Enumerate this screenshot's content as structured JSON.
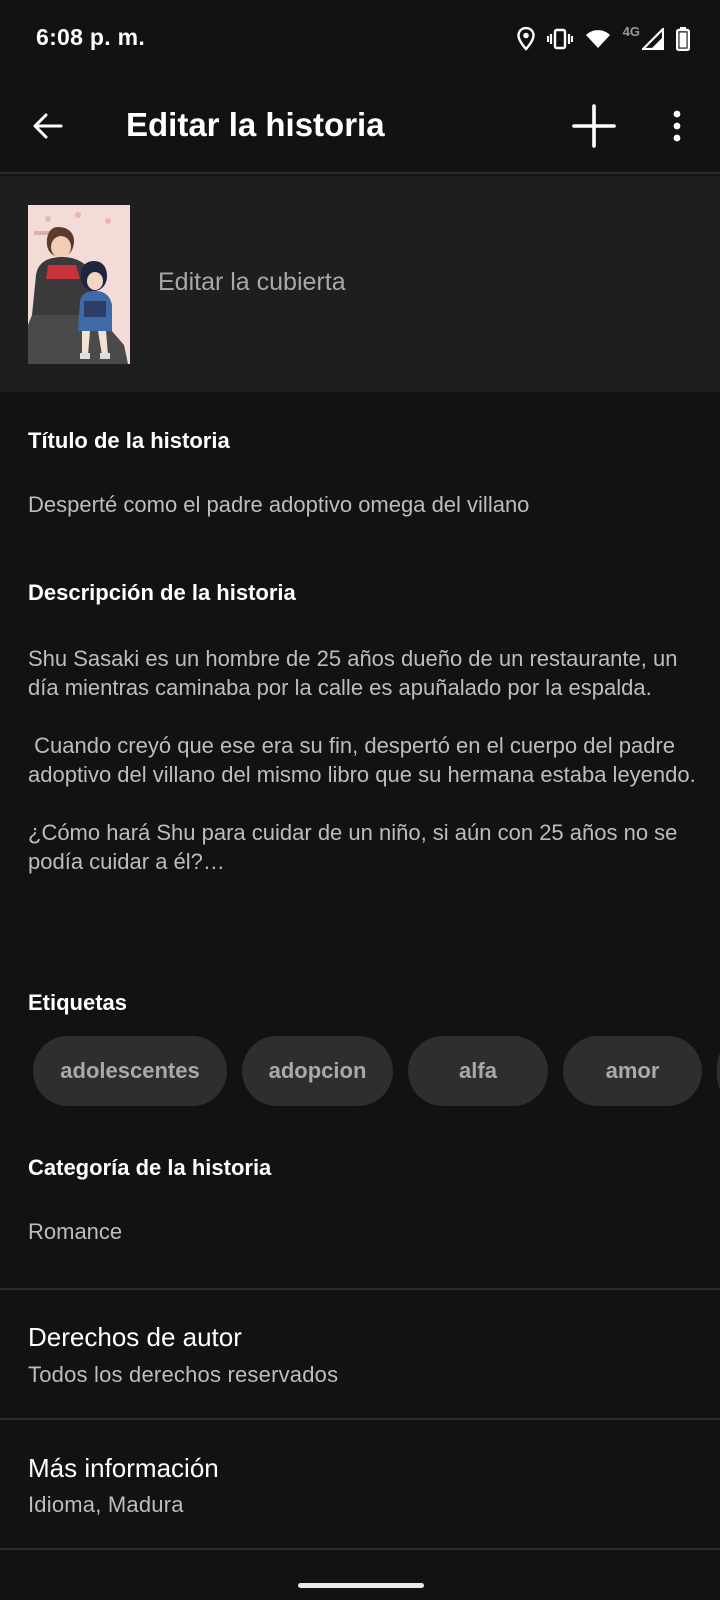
{
  "status": {
    "time": "6:08 p. m.",
    "network": "4G",
    "icons": [
      "location-icon",
      "vibrate-icon",
      "wifi-icon",
      "signal-icon",
      "battery-icon"
    ]
  },
  "appbar": {
    "title": "Editar la historia",
    "icons": [
      "back-arrow-icon",
      "plus-icon",
      "more-vert-icon"
    ]
  },
  "cover": {
    "label": "Editar la cubierta"
  },
  "story_title": {
    "label": "Título de la historia",
    "value": "Desperté como el padre adoptivo omega del villano"
  },
  "description": {
    "label": "Descripción de la historia",
    "paragraphs": [
      "Shu Sasaki es un hombre de 25 años dueño de un restaurante, un día mientras caminaba por la calle es apuñalado por la espalda.",
      " Cuando creyó que ese era su fin, despertó en el cuerpo del padre adoptivo del villano del mismo libro que su hermana estaba leyendo.",
      "¿Cómo hará Shu para cuidar de un niño, si aún con 25 años no se podía cuidar a él?…"
    ]
  },
  "tags": {
    "label": "Etiquetas",
    "items": [
      "adolescentes",
      "adopcion",
      "alfa",
      "amor",
      ""
    ]
  },
  "category": {
    "label": "Categoría de la historia",
    "value": "Romance"
  },
  "copyright": {
    "title": "Derechos de autor",
    "value": "Todos los derechos reservados"
  },
  "more_info": {
    "title": "Más información",
    "value": "Idioma, Madura"
  },
  "colors": {
    "background": "#121212",
    "surface": "#1e1e1e",
    "chip": "#2e2e2e",
    "text_primary": "#ffffff",
    "text_secondary": "#bdbdbd"
  }
}
